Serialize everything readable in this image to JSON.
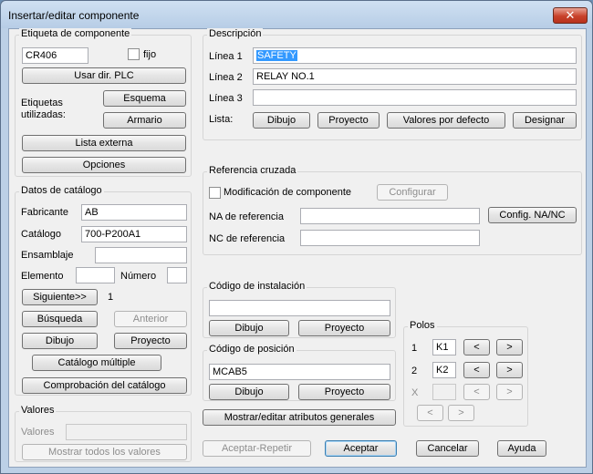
{
  "window": {
    "title": "Insertar/editar componente",
    "close_glyph": "✕"
  },
  "etiqueta": {
    "title": "Etiqueta de componente",
    "tag_value": "CR406",
    "fijo_label": "fijo",
    "usar_dir_plc": "Usar dir. PLC",
    "etiquetas_label": "Etiquetas\nutilizadas:",
    "esquema": "Esquema",
    "armario": "Armario",
    "lista_externa": "Lista externa",
    "opciones": "Opciones"
  },
  "datos": {
    "title": "Datos de catálogo",
    "fabricante_label": "Fabricante",
    "fabricante_value": "AB",
    "catalogo_label": "Catálogo",
    "catalogo_value": "700-P200A1",
    "ensamblaje_label": "Ensamblaje",
    "ensamblaje_value": "",
    "elemento_label": "Elemento",
    "elemento_value": "",
    "numero_label": "Número",
    "numero_value": "",
    "siguiente": "Siguiente>>",
    "siguiente_count": "1",
    "busqueda": "Búsqueda",
    "anterior": "Anterior",
    "dibujo": "Dibujo",
    "proyecto": "Proyecto",
    "catalogo_multiple": "Catálogo múltiple",
    "comprobacion": "Comprobación del catálogo"
  },
  "valores": {
    "title": "Valores",
    "valores_label": "Valores",
    "valores_value": "",
    "mostrar_todos": "Mostrar todos los valores"
  },
  "descripcion": {
    "title": "Descripción",
    "linea1_label": "Línea 1",
    "linea1_value": "SAFETY",
    "linea2_label": "Línea 2",
    "linea2_value": "RELAY NO.1",
    "linea3_label": "Línea 3",
    "linea3_value": "",
    "lista_label": "Lista:",
    "dibujo": "Dibujo",
    "proyecto": "Proyecto",
    "valores_defecto": "Valores por defecto",
    "designar": "Designar"
  },
  "referencia": {
    "title": "Referencia cruzada",
    "modificacion_label": "Modificación de componente",
    "configurar": "Configurar",
    "na_label": "NA de referencia",
    "na_value": "",
    "config_nanc": "Config. NA/NC",
    "nc_label": "NC de referencia",
    "nc_value": ""
  },
  "instalacion": {
    "title": "Código de instalación",
    "value": "",
    "dibujo": "Dibujo",
    "proyecto": "Proyecto"
  },
  "posicion": {
    "title": "Código de posición",
    "value": "MCAB5",
    "dibujo": "Dibujo",
    "proyecto": "Proyecto"
  },
  "polos": {
    "title": "Polos",
    "rows": [
      {
        "num": "1",
        "value": "K1"
      },
      {
        "num": "2",
        "value": "K2"
      },
      {
        "num": "X",
        "value": ""
      }
    ],
    "left": "<",
    "right": ">"
  },
  "mostrar_editar": "Mostrar/editar atributos generales",
  "footer": {
    "aceptar_repetir": "Aceptar-Repetir",
    "aceptar": "Aceptar",
    "cancelar": "Cancelar",
    "ayuda": "Ayuda"
  }
}
